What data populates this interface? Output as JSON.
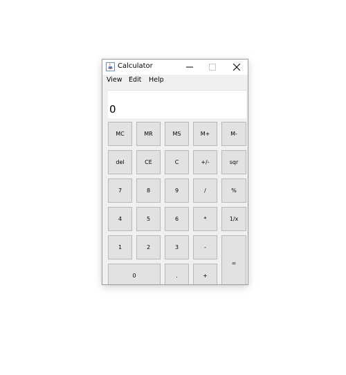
{
  "window": {
    "title": "Calculator",
    "minimize_glyph": "—",
    "maximize_glyph": "☐",
    "close_glyph": "✕"
  },
  "menu": [
    "View",
    "Edit",
    "Help"
  ],
  "display": {
    "value": "0"
  },
  "buttons": {
    "mc": "MC",
    "mr": "MR",
    "ms": "MS",
    "mplus": "M+",
    "mminus": "M-",
    "del": "del",
    "ce": "CE",
    "c": "C",
    "plusminus": "+/-",
    "sqr": "sqr",
    "seven": "7",
    "eight": "8",
    "nine": "9",
    "divide": "/",
    "percent": "%",
    "four": "4",
    "five": "5",
    "six": "6",
    "multiply": "*",
    "reciprocal": "1/x",
    "one": "1",
    "two": "2",
    "three": "3",
    "minus": "-",
    "equals": "=",
    "zero": "0",
    "dot": ".",
    "plus": "+"
  },
  "icons": {
    "app": "java-cup-icon"
  }
}
